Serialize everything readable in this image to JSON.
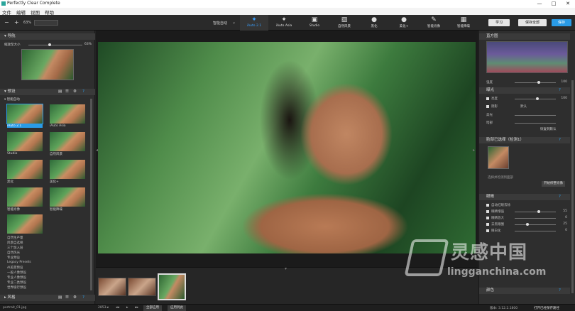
{
  "titlebar": {
    "title": "Perfectly Clear Complete",
    "controls": [
      "—",
      "□",
      "✕"
    ]
  },
  "menubar": [
    "文件",
    "编辑",
    "视图",
    "帮助"
  ],
  "toolbar": {
    "zoom_minus": "−",
    "zoom_plus": "+",
    "zoom_value": "63%",
    "preset_mode": "智能自动",
    "presets": [
      {
        "label": "iAuto 2.1",
        "icon": "magic-wand-icon"
      },
      {
        "label": "iAuto Asia",
        "icon": "magic-wand-icon"
      },
      {
        "label": "Studio",
        "icon": "portrait-icon"
      },
      {
        "label": "自然风景",
        "icon": "landscape-icon"
      },
      {
        "label": "黑化",
        "icon": "balloon-icon"
      },
      {
        "label": "美化+",
        "icon": "balloon-icon"
      },
      {
        "label": "智能肖像",
        "icon": "brush-icon"
      },
      {
        "label": "智能降噪",
        "icon": "grid-icon"
      }
    ],
    "learn_button": "学习",
    "save_all_button": "保存全部",
    "save_button": "保存"
  },
  "left": {
    "nav_header": "导航",
    "zoom_label": "缩放至大小",
    "zoom_value": "63%",
    "presets_header": "预设",
    "group_label": "智能自动",
    "thumbs": [
      {
        "label": "iAuto 2.1",
        "selected": true
      },
      {
        "label": "iAuto Asia"
      },
      {
        "label": "Studio"
      },
      {
        "label": "自然风景"
      },
      {
        "label": "黑化"
      },
      {
        "label": "美化+"
      },
      {
        "label": "智能肖像"
      },
      {
        "label": "智能降噪"
      },
      {
        "label": ""
      }
    ],
    "tree": [
      "自然生产量",
      "风景自选择",
      "三个加入层",
      "自然风光",
      "专业预设",
      "Legacy Presets",
      "AI美景预设",
      "一般人像预设",
      "专业人像预设",
      "专业二类预设",
      "世界级行预设"
    ],
    "bottom_header": "风格"
  },
  "right": {
    "histogram_header": "直方图",
    "strength_label": "强度",
    "strength_value": "100",
    "exposure_header": "曝光",
    "rows1": [
      {
        "label": "亮度",
        "value": "100"
      },
      {
        "label": "阴影",
        "value": "默认"
      },
      {
        "label": "高光",
        "value": ""
      },
      {
        "label": "暗部",
        "value": ""
      }
    ],
    "auto_button": "恢复到默认",
    "face_header": "脸部已选择（检测1）",
    "face_note": "选择并检测到面部",
    "face_button": "开始修整肖像",
    "face_section": "眼睛",
    "rows2": [
      {
        "label": "自动红眼去除",
        "value": ""
      },
      {
        "label": "眼睛增强",
        "value": "55"
      },
      {
        "label": "眼睛放大",
        "value": "0"
      },
      {
        "label": "去黑眼圈",
        "value": "25"
      },
      {
        "label": "眼白化",
        "value": "0"
      }
    ],
    "color_header": "颜色"
  },
  "status": {
    "filename": "portrait_01.jpg",
    "size": "2853",
    "btn_all": "全部应用",
    "btn_apply": "应用到此",
    "version": "版本: 3.12.2.1800",
    "link": "打开已经保存路径"
  },
  "watermark": {
    "cn": "灵感中国",
    "en": "lingganchina.com"
  }
}
